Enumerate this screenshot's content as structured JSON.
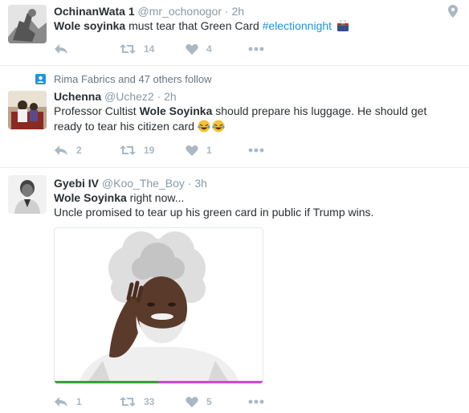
{
  "tweets": [
    {
      "name": "OchinanWata 1",
      "handle": "@mr_ochonogor",
      "time": "· 2h",
      "text_bold": "Wole soyinka",
      "text_rest": " must tear that Green Card ",
      "hashtag": "#electionnight",
      "retweets": "14",
      "likes": "4"
    },
    {
      "social": "Rima Fabrics and 47 others follow",
      "name": "Uchenna",
      "handle": "@Uchez2",
      "time": "· 2h",
      "text_pre": "Professor Cultist ",
      "text_bold": "Wole Soyinka",
      "text_rest": " should prepare his luggage. He should get",
      "text_line2": "ready to tear his citizen card ",
      "replies": "2",
      "retweets": "19",
      "likes": "1"
    },
    {
      "name": "Gyebi IV",
      "handle": "@Koo_The_Boy",
      "time": "· 3h",
      "text_bold": "Wole Soyinka",
      "text_rest": " right now...",
      "text_line2": "Uncle promised to tear up his green card in public if Trump wins.",
      "replies": "1",
      "retweets": "33",
      "likes": "5"
    }
  ],
  "icons": {
    "reply": "reply-icon",
    "retweet": "retweet-icon",
    "like": "heart-icon",
    "more": "more-icon",
    "pin": "location-pin-icon",
    "follow": "person-icon"
  },
  "colors": {
    "name": "#292f33",
    "muted": "#8899a6",
    "action": "#aab8c2",
    "hashtag": "#1b95e0",
    "divider": "#e6ecf0"
  }
}
